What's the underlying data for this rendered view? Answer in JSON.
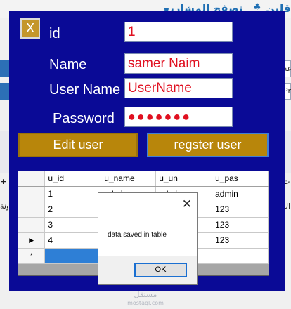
{
  "background": {
    "top_link_1": "تصفح المشاريع",
    "top_link_2": "قلين",
    "side_label_1": "عة",
    "side_label_2": "Prog",
    "side_label_3": "م ت",
    "side_label_4": "UI",
    "side_label_5": "ونة",
    "watermark": "مستقل",
    "watermark_sub": "mostaql.com"
  },
  "form": {
    "close_label": "X",
    "labels": {
      "id": "id",
      "name": "Name",
      "user_name": "User Name",
      "password": "Password"
    },
    "values": {
      "id": "1",
      "name": "samer Naim",
      "user_name": "UserName",
      "password": "●●●●●●●"
    },
    "edit_button": "Edit user",
    "register_button": "regster user"
  },
  "grid": {
    "columns": [
      "u_id",
      "u_name",
      "u_un",
      "u_pas"
    ],
    "rows": [
      {
        "u_id": "1",
        "u_name": "admin",
        "u_un": "admin",
        "u_pas": "admin"
      },
      {
        "u_id": "2",
        "u_name": "",
        "u_un": "",
        "u_pas": "123"
      },
      {
        "u_id": "3",
        "u_name": "",
        "u_un": "",
        "u_pas": "123"
      },
      {
        "u_id": "4",
        "u_name": "",
        "u_un": "",
        "u_pas": "123"
      }
    ],
    "current_row_marker": "▶",
    "new_row_marker": "*"
  },
  "message_box": {
    "text": "data saved in table",
    "ok_label": "OK",
    "close_label": "✕"
  },
  "colors": {
    "form_background": "#0a0a96",
    "button": "#b8860b",
    "field_text": "#e01020"
  }
}
